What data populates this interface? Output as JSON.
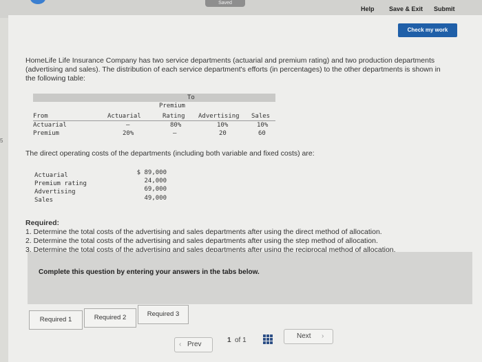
{
  "header": {
    "saved": "Saved",
    "help": "Help",
    "save_exit": "Save & Exit",
    "submit": "Submit"
  },
  "check_button": "Check my work",
  "intro": "HomeLife Life Insurance Company has two service departments (actuarial and premium rating) and two production departments (advertising and sales). The distribution of each service department's efforts (in percentages) to the other departments is shown in the following table:",
  "distribution_table": {
    "to_label": "To",
    "from_label": "From",
    "columns": [
      "Actuarial",
      "Premium Rating",
      "Advertising",
      "Sales"
    ],
    "rows": [
      {
        "label": "Actuarial",
        "values": [
          "—",
          "80%",
          "10%",
          "10%"
        ]
      },
      {
        "label": "Premium",
        "values": [
          "20%",
          "—",
          "20",
          "60"
        ]
      }
    ]
  },
  "costs_intro": "The direct operating costs of the departments (including both variable and fixed costs) are:",
  "costs": [
    {
      "label": "Actuarial",
      "value": "$ 89,000"
    },
    {
      "label": "Premium rating",
      "value": "24,000"
    },
    {
      "label": "Advertising",
      "value": "69,000"
    },
    {
      "label": "Sales",
      "value": "49,000"
    }
  ],
  "required": {
    "heading": "Required:",
    "items": [
      "1. Determine the total costs of the advertising and sales departments after using the direct method of allocation.",
      "2. Determine the total costs of the advertising and sales departments after using the step method of allocation.",
      "3. Determine the total costs of the advertising and sales departments after using the reciprocal method of allocation."
    ]
  },
  "complete_prompt": "Complete this question by entering your answers in the tabs below.",
  "tabs": [
    "Required 1",
    "Required 2",
    "Required 3"
  ],
  "pager": {
    "prev": "Prev",
    "page": "1",
    "of": "of 1",
    "next": "Next"
  },
  "side_mark": "5"
}
